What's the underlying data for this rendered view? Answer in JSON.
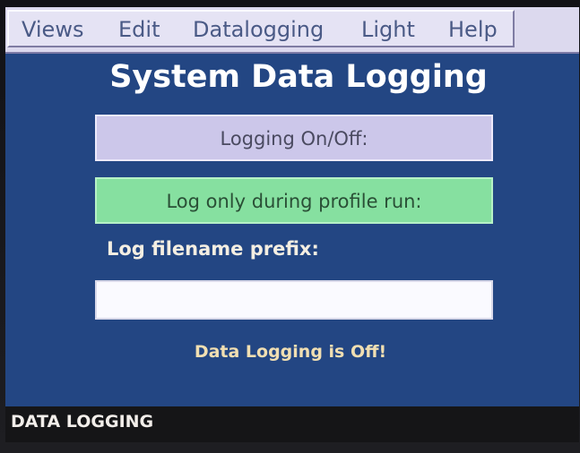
{
  "menu": {
    "items": [
      "Views",
      "Edit",
      "Datalogging",
      "Light",
      "Help"
    ]
  },
  "title": "System Data Logging",
  "buttons": {
    "logging_toggle": "Logging On/Off:",
    "profile_run": "Log only during profile run:"
  },
  "filename_prefix": {
    "label": "Log filename prefix:",
    "value": ""
  },
  "status": "Data Logging is Off!",
  "status_bar": {
    "label": "DATA LOGGING"
  }
}
